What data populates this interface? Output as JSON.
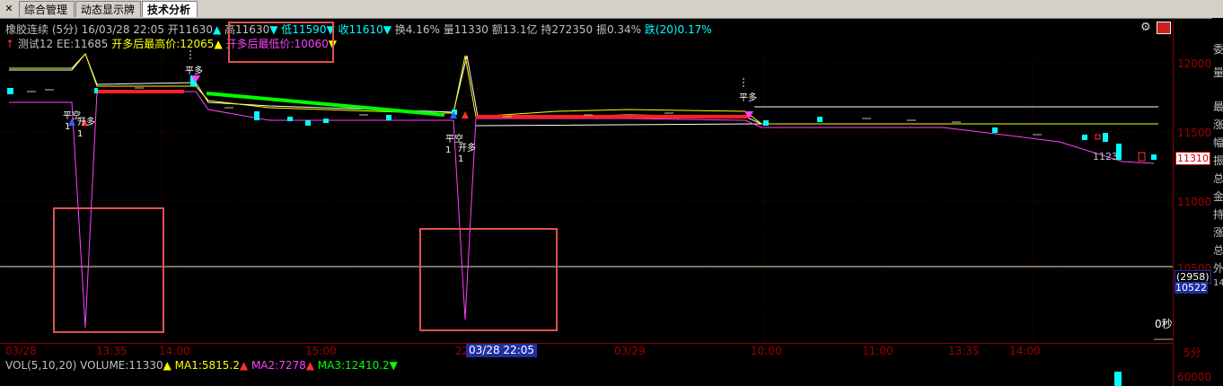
{
  "tabs": [
    {
      "label": "综合管理"
    },
    {
      "label": "动态显示牌"
    },
    {
      "label": "技术分析",
      "active": true
    }
  ],
  "header": {
    "symbol": "橡胶连续 (5分)",
    "datetime": "16/03/28 22:05",
    "open": "开11630",
    "high": "高11630",
    "low": "低11590",
    "close": "收11610",
    "turnover": "换4.16%",
    "volume": "量11330",
    "amount": "额13.1亿",
    "hold": "持272350",
    "amplitude": "振0.34%",
    "change": "跌(20)0.17%"
  },
  "indicator": {
    "name": "测试12",
    "ee": "EE:11685",
    "max_after_long": "开多后最高价:12065",
    "min_after_long": "开多后最低价:10060"
  },
  "yaxis": [
    "12000",
    "11500",
    "11000",
    "10500",
    "60000"
  ],
  "price_badges": {
    "last": "11310",
    "diff": "(2958)",
    "bottom": "10522"
  },
  "xaxis": [
    "03/28",
    "13:35",
    "14:00",
    "15:00",
    "22",
    "03/29",
    "10:00",
    "11:00",
    "13:35",
    "14:00"
  ],
  "crosshair_label": "03/28 22:05",
  "timeframe": "5分",
  "countdown": "0秒",
  "chart_annotations": {
    "pingkong": "平空",
    "kaiduo": "开多",
    "pingduo": "平多",
    "one": "1",
    "price_label": "1123"
  },
  "vol_line": {
    "label": "VOL(5,10,20)",
    "volume": "VOLUME:11330",
    "ma1": "MA1:5815.2",
    "ma2": "MA2:7278",
    "ma3": "MA3:12410.2"
  },
  "right_strip": [
    "委",
    "量",
    "最",
    "涨",
    "幅",
    "振",
    "总",
    "金",
    "持",
    "涨",
    "总",
    "外",
    "14"
  ],
  "colors": {
    "up": "#ff3030",
    "down": "#00ffff",
    "magenta": "#ff40ff",
    "yellow": "#ffff00",
    "green": "#00ff00",
    "axis": "#a00000"
  }
}
